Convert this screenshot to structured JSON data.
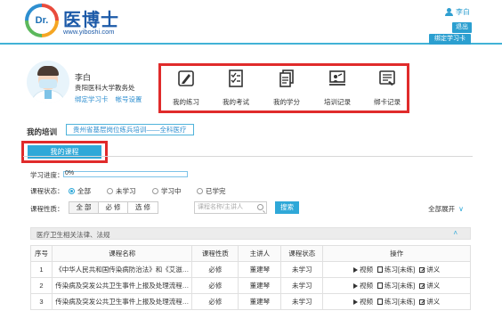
{
  "header": {
    "logo_mark": "Dr.",
    "title": "医博士",
    "url": "www.yiboshi.com",
    "user_name": "李白",
    "logout_label": "退出",
    "bind_card_label": "绑定学习卡"
  },
  "profile": {
    "name": "李白",
    "institution": "贵阳医科大学教务处",
    "bind_card_link": "绑定学习卡",
    "account_settings_link": "帐号设置"
  },
  "quick_menu": [
    {
      "label": "我的练习",
      "icon": "pencil-icon"
    },
    {
      "label": "我的考试",
      "icon": "checklist-icon"
    },
    {
      "label": "我的学分",
      "icon": "document-icon"
    },
    {
      "label": "培训记录",
      "icon": "presenter-icon"
    },
    {
      "label": "绑卡记录",
      "icon": "card-record-icon"
    }
  ],
  "training": {
    "label": "我的培训",
    "tab": "贵州省基层岗位练兵培训——全科医疗"
  },
  "my_course_tab": "我的课程",
  "filters": {
    "progress_label": "学习进度：",
    "progress_text": "0%",
    "progress_value": 0,
    "status_label": "课程状态：",
    "status_options": [
      "全部",
      "未学习",
      "学习中",
      "已学完"
    ],
    "nature_label": "课程性质：",
    "nature_options": [
      "全 部",
      "必 修",
      "选 修"
    ],
    "search_placeholder": "课程名称/主讲人",
    "search_button": "搜索",
    "expand_all": "全部展开"
  },
  "section": {
    "title": "医疗卫生相关法律、法规",
    "collapse_icon": "chevron-up-icon"
  },
  "table": {
    "headers": [
      "序号",
      "课程名称",
      "课程性质",
      "主讲人",
      "课程状态",
      "操作"
    ],
    "rows": [
      {
        "no": "1",
        "name": "《中华人民共和国传染病防治法》和《艾滋…",
        "nature": "必修",
        "lecturer": "董建琴",
        "status": "未学习",
        "video": "视频",
        "practice": "练习[未练]",
        "notes": "讲义"
      },
      {
        "no": "2",
        "name": "传染病及突发公共卫生事件上报及处理流程…",
        "nature": "必修",
        "lecturer": "董建琴",
        "status": "未学习",
        "video": "视频",
        "practice": "练习[未练]",
        "notes": "讲义"
      },
      {
        "no": "3",
        "name": "传染病及突发公共卫生事件上报及处理流程…",
        "nature": "必修",
        "lecturer": "董建琴",
        "status": "未学习",
        "video": "视频",
        "practice": "练习[未练]",
        "notes": "讲义"
      }
    ]
  },
  "colors": {
    "accent": "#2fa8d8",
    "brand": "#1c5aa8",
    "highlight_border": "#e02b2b"
  }
}
